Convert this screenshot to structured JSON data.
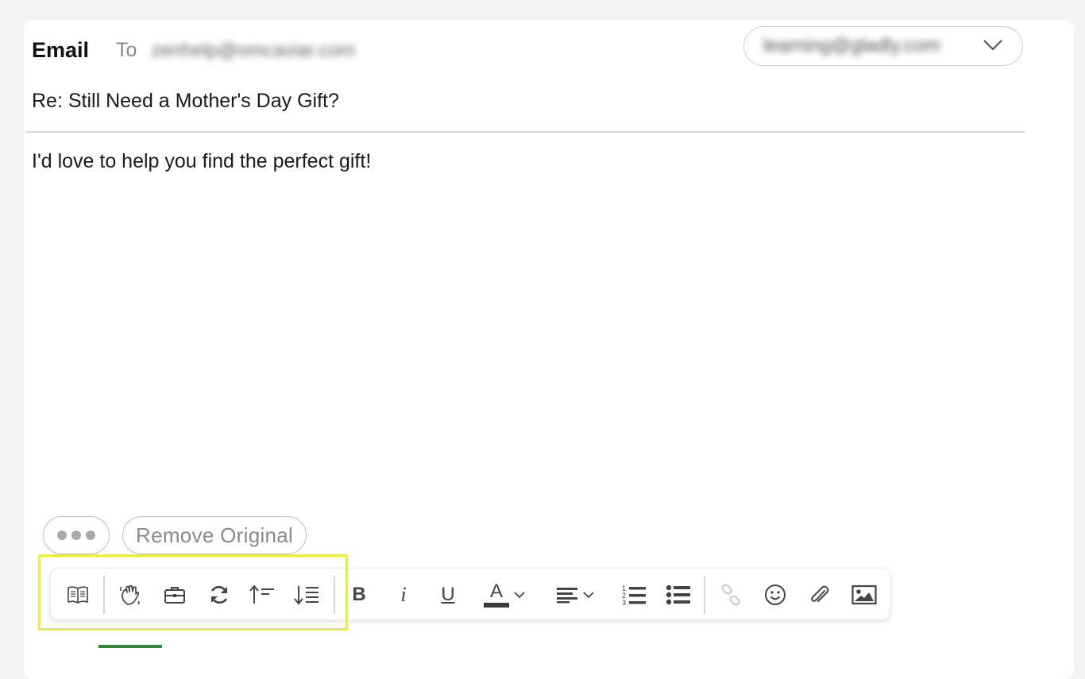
{
  "composer": {
    "channel_label": "Email",
    "to_label": "To",
    "to_value": "zenhelp@omcaviar.com",
    "from_value": "learning@gladly.com",
    "subject": "Re: Still Need a Mother's Day Gift?",
    "body": "I'd love to help you find the perfect gift!",
    "remove_original_label": "Remove Original"
  },
  "toolbar": {
    "groups": [
      [
        "answers-book-icon"
      ],
      [
        "waving-hand-icon",
        "briefcase-icon",
        "refresh-icon",
        "sort-ascending-icon",
        "sort-descending-icon"
      ],
      [
        "bold-icon",
        "italic-icon",
        "underline-icon",
        "text-color-icon",
        "align-icon",
        "numbered-list-icon",
        "bullet-list-icon"
      ],
      [
        "link-icon",
        "emoji-icon",
        "attachment-icon",
        "image-icon"
      ]
    ],
    "bold_glyph": "B",
    "italic_glyph": "i",
    "underline_glyph": "U",
    "text_color_glyph": "A",
    "highlight_color": "#e8ef3a"
  }
}
